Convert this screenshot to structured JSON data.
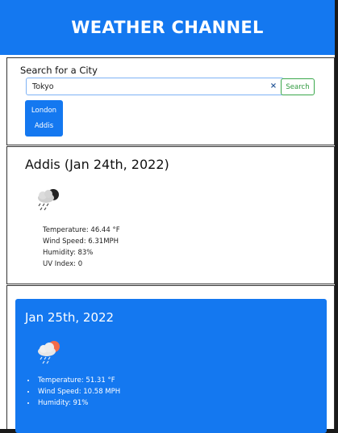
{
  "header": {
    "title": "WEATHER CHANNEL"
  },
  "search": {
    "label": "Search for a City",
    "value": "Tokyo",
    "clear_symbol": "×",
    "button_label": "Search",
    "history": [
      "London",
      "Addis"
    ]
  },
  "current": {
    "title": "Addis (Jan 24th, 2022)",
    "icon": "night-cloud-rain-icon",
    "temperature": "Temperature: 46.44 °F",
    "wind": "Wind Speed: 6.31MPH",
    "humidity": "Humidity: 83%",
    "uv": "UV Index: 0"
  },
  "forecast": {
    "date": "Jan 25th, 2022",
    "icon": "sun-cloud-rain-icon",
    "temperature": "Temperature: 51.31 °F",
    "wind": "Wind Speed: 10.58 MPH",
    "humidity": "Humidity: 91%"
  },
  "colors": {
    "accent": "#1478f0",
    "search_button": "#3aa84b",
    "background": "#ffffff"
  }
}
